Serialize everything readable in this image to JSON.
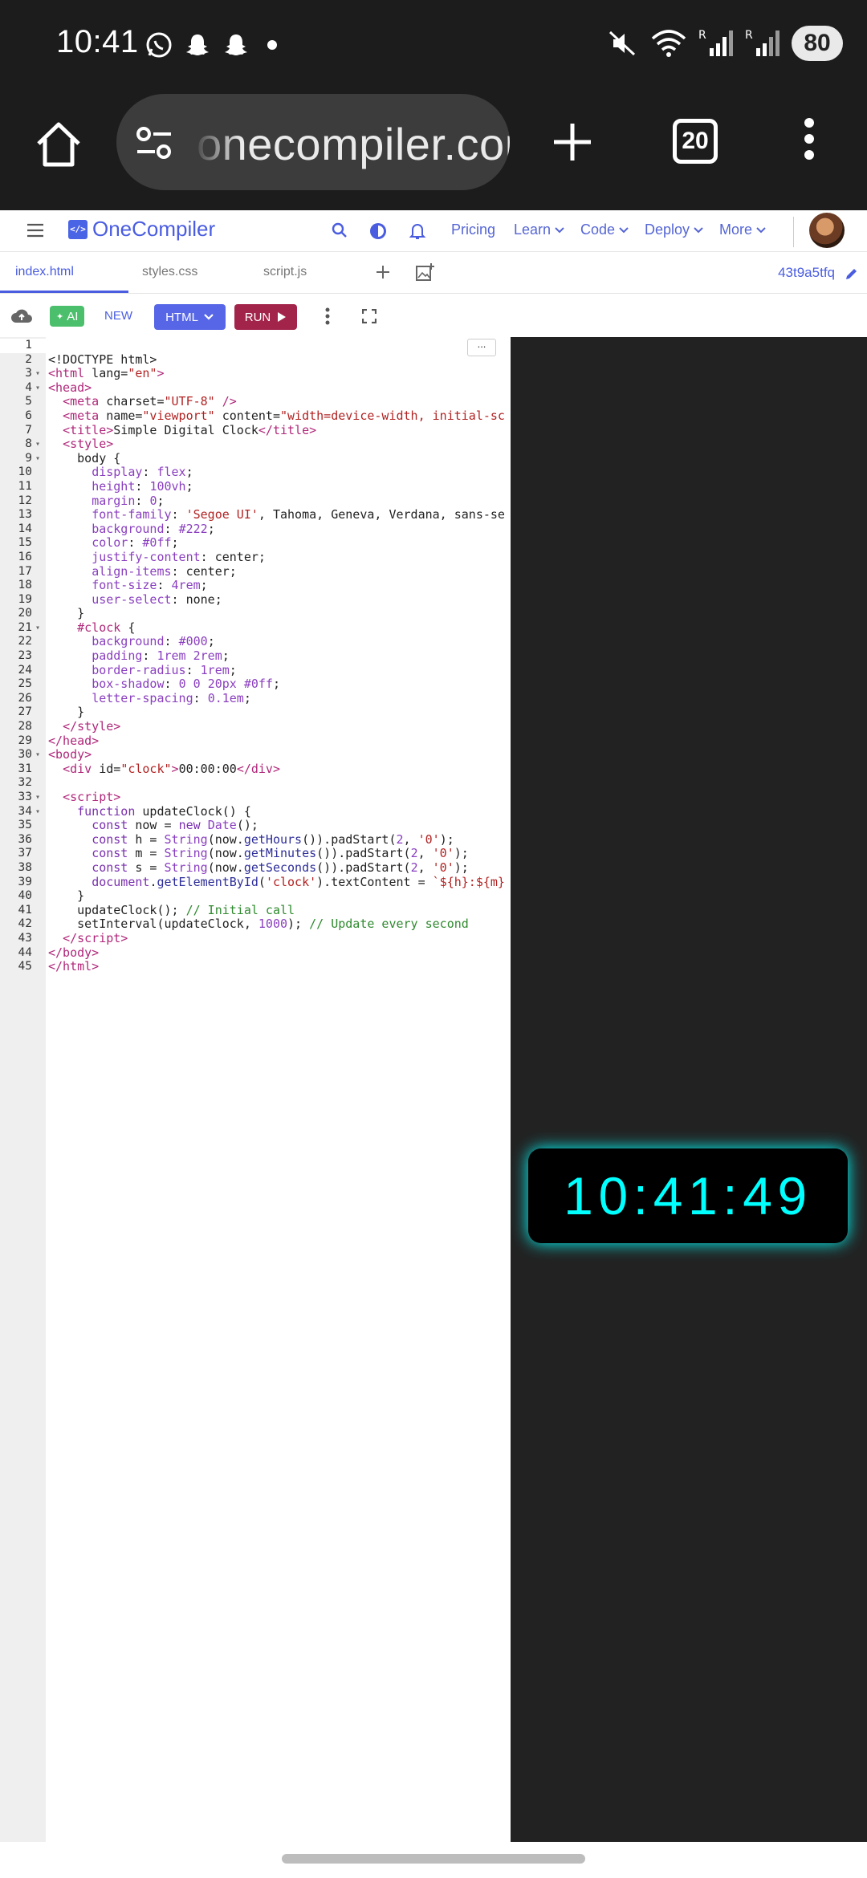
{
  "status_bar": {
    "time": "10:41",
    "battery": "80"
  },
  "browser": {
    "url": "onecompiler.com",
    "tab_count": "20"
  },
  "header": {
    "logo_mark": "</>",
    "brand": "OneCompiler",
    "nav": [
      "Pricing",
      "Learn",
      "Code",
      "Deploy",
      "More"
    ]
  },
  "file_tabs": {
    "tabs": [
      "index.html",
      "styles.css",
      "script.js"
    ],
    "active": "index.html",
    "file_id": "43t9a5tfq"
  },
  "toolbar": {
    "ai": "AI",
    "new": "NEW",
    "language": "HTML",
    "run": "RUN",
    "more_menu": "..."
  },
  "editor": {
    "line_count": 45
  },
  "preview": {
    "clock_text": "10:41:49",
    "clock_color": "#00ffff",
    "background": "#222222"
  }
}
